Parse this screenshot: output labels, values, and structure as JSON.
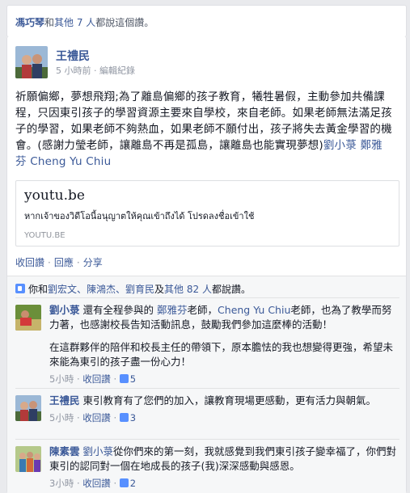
{
  "top_like": {
    "name": "馮巧琴",
    "middle": "和",
    "others": "其他 7 人",
    "tail": "都說這個讚。"
  },
  "post": {
    "author": "王禮民",
    "time": "5 小時前",
    "edit_history": "編輯紀錄",
    "body_text": "祈願偏鄉，夢想飛翔;為了離島偏鄉的孩子教育，犧牲暑假，主動參加共備課程，只因東引孩子的學習資源主要來自學校，來自老師。如果老師無法滿足孩子的學習，如果老師不夠熱血，如果老師不願付出，孩子將失去黃金學習的機會。(感謝力瑩老師，讓離島不再是孤島，讓離島也能實現夢想)",
    "tag1": "劉小菉",
    "tag2": "鄭雅芬",
    "tag3": "Cheng Yu Chiu",
    "preview": {
      "title": "youtu.be",
      "description": "หากเจ้าของวิดีโอนี้อนุญาตให้คุณเข้าถึงได้ โปรดลงชื่อเข้าใช้",
      "domain": "YOUTU.BE"
    },
    "actions": {
      "unlike": "收回讚",
      "reply": "回應",
      "share": "分享",
      "separator": "·"
    }
  },
  "likes_summary": {
    "prefix": "你和",
    "people": "劉宏文、陳鴻杰、劉育民",
    "and_others": "及",
    "others": "其他 82 人",
    "suffix": "都說讚。"
  },
  "comments": [
    {
      "author": "劉小菉",
      "text_a": "還有全程參與的",
      "tag_a": "鄭雅芬",
      "text_b": "老師，",
      "tag_b": "Cheng Yu Chiu",
      "text_c": "老師，也為了教學而努力著，也感謝校長告知活動訊息，鼓勵我們參加這麼棒的活動！",
      "text_d": "在這群夥伴的陪伴和校長主任的帶領下，原本膽怯的我也想變得更強，希望未來能為東引的孩子盡一份心力！",
      "time": "5小時",
      "action": "收回讚",
      "likes": "5"
    },
    {
      "author": "王禮民",
      "text": "東引教育有了您們的加入，讓教育現場更感動，更有活力與朝氣。",
      "time": "5小時",
      "action": "收回讚",
      "likes": "3"
    },
    {
      "author": "陳素雲",
      "tag": "劉小菉",
      "text": "從你們來的第一刻，我就感覺到我們東引孩子變幸福了，你們對東引的認同對一個在地成長的孩子(我)深深感動與感恩。",
      "time": "3小時",
      "action": "收回讚",
      "likes": "2"
    }
  ],
  "middot": "·",
  "colors": {
    "link": "#3b5998",
    "muted": "#9197a3",
    "background": "#e9eaed",
    "feedback_bg": "#f6f7f8"
  }
}
